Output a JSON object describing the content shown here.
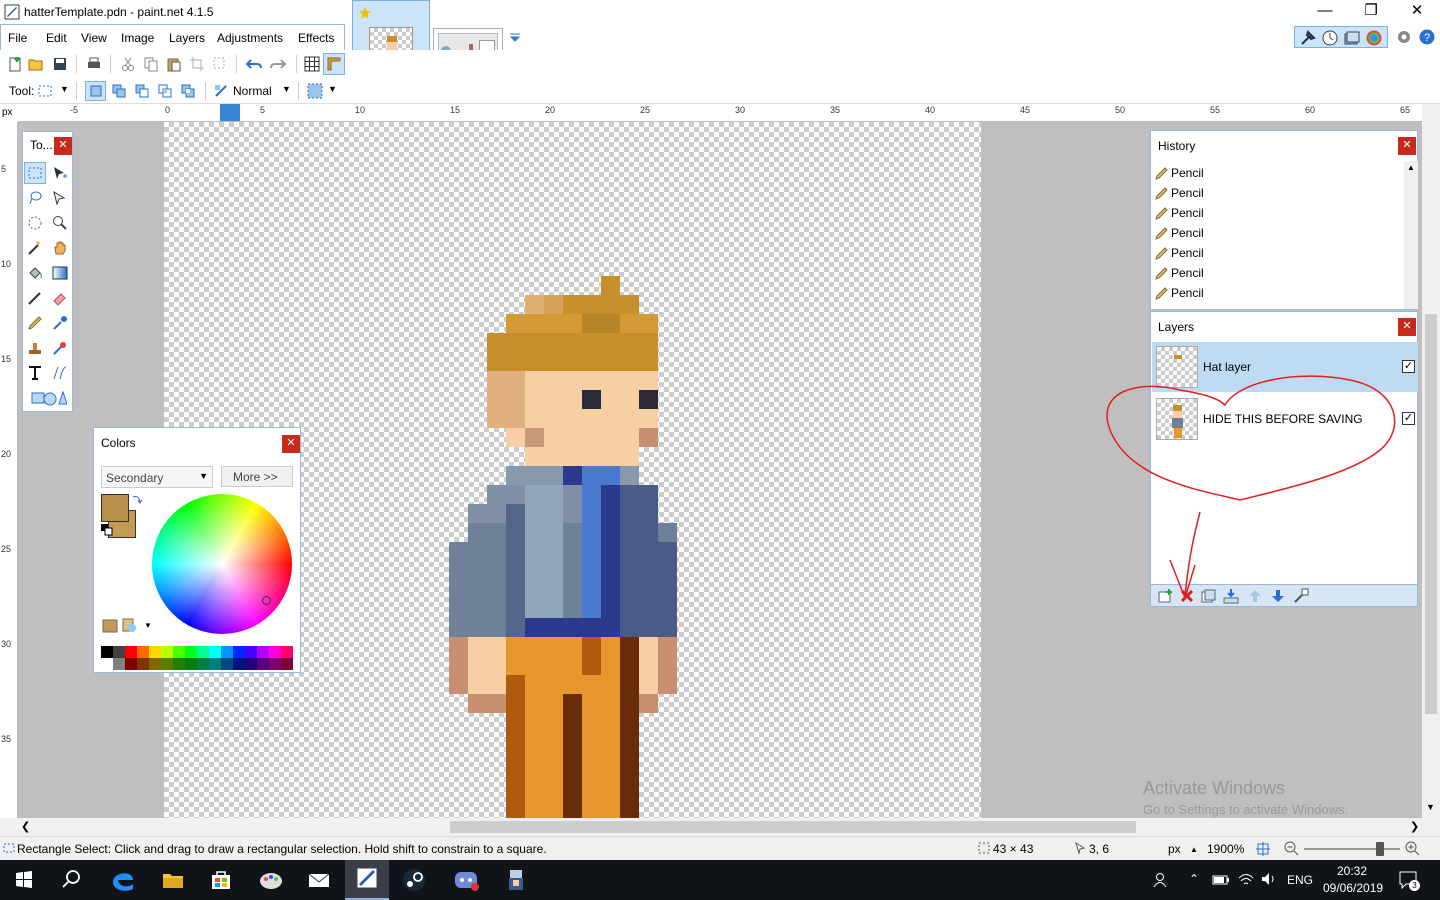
{
  "window": {
    "title": "hatterTemplate.pdn - paint.net 4.1.5"
  },
  "menu": [
    "File",
    "Edit",
    "View",
    "Image",
    "Layers",
    "Adjustments",
    "Effects"
  ],
  "toolbar2": {
    "tool_label": "Tool:",
    "blend_mode": "Normal"
  },
  "ruler": {
    "unit": "px",
    "top_ticks": [
      "-5",
      "0",
      "5",
      "10",
      "15",
      "20",
      "25",
      "30",
      "35",
      "40",
      "45",
      "50",
      "55",
      "60",
      "65"
    ],
    "left_ticks": [
      "5",
      "10",
      "15",
      "20",
      "25",
      "30",
      "35"
    ]
  },
  "tools_panel": {
    "title": "To..."
  },
  "colors_panel": {
    "title": "Colors",
    "mode": "Secondary",
    "more_label": "More >>",
    "primary_color": "#b8914f",
    "secondary_color": "#c49a55"
  },
  "history_panel": {
    "title": "History",
    "items": [
      "Pencil",
      "Pencil",
      "Pencil",
      "Pencil",
      "Pencil",
      "Pencil",
      "Pencil"
    ]
  },
  "layers_panel": {
    "title": "Layers",
    "layers": [
      {
        "name": "Hat layer",
        "visible": true,
        "selected": true
      },
      {
        "name": "HIDE THIS BEFORE SAVING",
        "visible": true,
        "selected": false
      }
    ]
  },
  "statusbar": {
    "hint": "Rectangle Select: Click and drag to draw a rectangular selection. Hold shift to constrain to a square.",
    "selection_size": "43 × 43",
    "cursor_pos": "3, 6",
    "unit": "px",
    "zoom": "1900%"
  },
  "watermark": {
    "line1": "Activate Windows",
    "line2": "Go to Settings to activate Windows."
  },
  "taskbar": {
    "language": "ENG",
    "time": "20:32",
    "date": "09/06/2019",
    "notifications": "3"
  }
}
